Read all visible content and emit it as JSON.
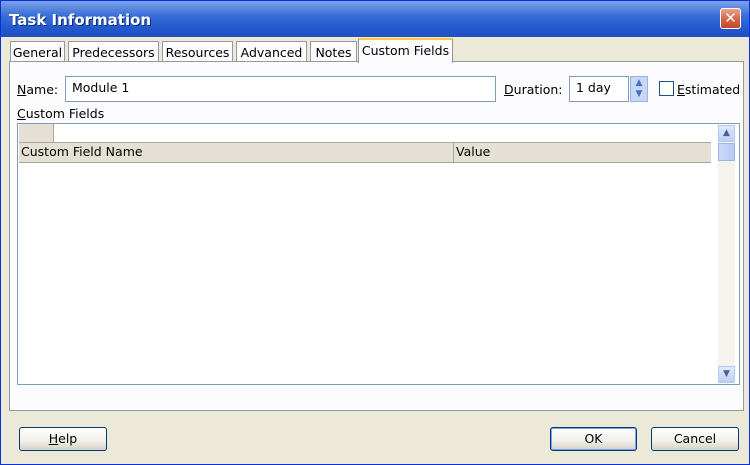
{
  "window": {
    "title": "Task Information",
    "close_glyph": "✕"
  },
  "tabs": [
    {
      "label": "General"
    },
    {
      "label": "Predecessors"
    },
    {
      "label": "Resources"
    },
    {
      "label": "Advanced"
    },
    {
      "label": "Notes"
    },
    {
      "label": "Custom Fields",
      "active": true
    }
  ],
  "form": {
    "name_label_u": "N",
    "name_label_rest": "ame:",
    "name_value": "Module 1",
    "duration_label_u": "D",
    "duration_label_rest": "uration:",
    "duration_value": "1 day",
    "estimated_label_u": "E",
    "estimated_label_rest": "stimated",
    "estimated_checked": false,
    "section_label_u": "C",
    "section_label_rest": "ustom Fields"
  },
  "grid": {
    "columns": [
      "Custom Field Name",
      "Value"
    ],
    "rows": []
  },
  "buttons": {
    "help_u": "H",
    "help_rest": "elp",
    "ok": "OK",
    "cancel": "Cancel"
  },
  "icons": {
    "spin_up": "▲",
    "spin_down": "▼",
    "scroll_up": "▲",
    "scroll_down": "▼"
  },
  "colors": {
    "titlebar": "#2459cf",
    "dialog_bg": "#ece9d8",
    "active_tab_accent": "#ffc83c"
  }
}
